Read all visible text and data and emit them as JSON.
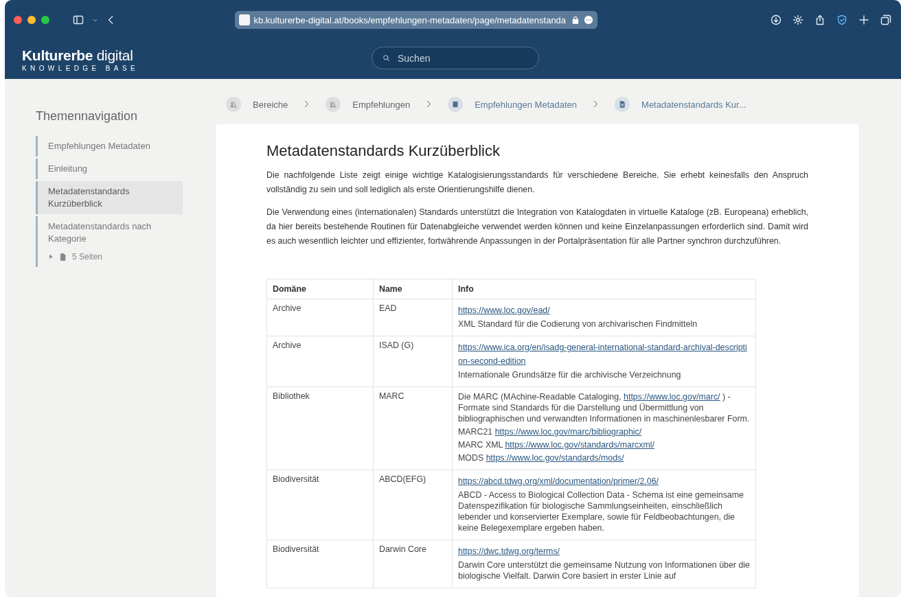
{
  "browser": {
    "url": "kb.kulturerbe-digital.at/books/empfehlungen-metadaten/page/metadatenstanda"
  },
  "site": {
    "logo_bold": "Kulturerbe",
    "logo_light": "digital",
    "tagline": "KNOWLEDGE BASE",
    "search": {
      "placeholder": "Suchen"
    }
  },
  "sidebar": {
    "title": "Themennavigation",
    "items": [
      {
        "label": "Empfehlungen Metadaten",
        "selected": false
      },
      {
        "label": "Einleitung",
        "selected": false
      },
      {
        "label": "Metadatenstandards Kurzüberblick",
        "selected": true
      },
      {
        "label": "Metadatenstandards nach Kategorie",
        "selected": false,
        "pages": {
          "label": "5 Seiten",
          "expanded": false
        }
      }
    ]
  },
  "breadcrumbs": [
    {
      "label": "Bereiche",
      "kind": "shelves"
    },
    {
      "label": "Empfehlungen",
      "kind": "shelves"
    },
    {
      "label": "Empfehlungen Metadaten",
      "kind": "book"
    },
    {
      "label": "Metadatenstandards Kur...",
      "kind": "page"
    }
  ],
  "page": {
    "title": "Metadatenstandards Kurzüberblick",
    "paragraphs": [
      "Die nachfolgende Liste zeigt einige wichtige Katalogisierungsstandards für verschiedene Bereiche. Sie erhebt keinesfalls den Anspruch vollständig zu sein und soll lediglich als erste Orientierungshilfe dienen.",
      "Die Verwendung eines (internationalen) Standards unterstützt die Integration von Katalogdaten in virtuelle Kataloge (zB. Europeana) erheblich, da hier bereits bestehende Routinen für Datenabgleiche verwendet werden können und keine Einzelanpassungen erforderlich sind. Damit wird es auch wesentlich leichter und effizienter, fortwährende Anpassungen in der Portalpräsentation für alle Partner synchron durchzuführen."
    ]
  },
  "table": {
    "columns": [
      "Domäne",
      "Name",
      "Info"
    ],
    "rows": [
      {
        "domain": "Archive",
        "name": "EAD",
        "info": [
          [
            {
              "kind": "link",
              "text": "https://www.loc.gov/ead/"
            }
          ],
          [
            {
              "kind": "text",
              "text": "XML Standard für die Codierung von archivarischen Findmitteln"
            }
          ]
        ]
      },
      {
        "domain": "Archive",
        "name": "ISAD (G)",
        "info": [
          [
            {
              "kind": "link",
              "text": "https://www.ica.org/en/isadg-general-international-standard-archival-description-second-edition"
            }
          ],
          [
            {
              "kind": "text",
              "text": "Internationale Grundsätze für die archivische Verzeichnung"
            }
          ]
        ]
      },
      {
        "domain": "Bibliothek",
        "name": "MARC",
        "info": [
          [
            {
              "kind": "text",
              "text": "Die MARC (MAchine-Readable Cataloging, "
            },
            {
              "kind": "link",
              "text": "https://www.loc.gov/marc/"
            },
            {
              "kind": "text",
              "text": " ) - Formate sind Standards für die Darstellung und Übermittlung von bibliographischen und verwandten Informationen in maschinenlesbarer Form."
            }
          ],
          [
            {
              "kind": "text",
              "text": "MARC21 "
            },
            {
              "kind": "link",
              "text": "https://www.loc.gov/marc/bibliographic/"
            }
          ],
          [
            {
              "kind": "text",
              "text": "MARC XML "
            },
            {
              "kind": "link",
              "text": "https://www.loc.gov/standards/marcxml/"
            }
          ],
          [
            {
              "kind": "text",
              "text": "MODS "
            },
            {
              "kind": "link",
              "text": "https://www.loc.gov/standards/mods/"
            }
          ]
        ]
      },
      {
        "domain": "Biodiversität",
        "name": "ABCD(EFG)",
        "info": [
          [
            {
              "kind": "link",
              "text": "https://abcd.tdwg.org/xml/documentation/primer/2.06/"
            }
          ],
          [
            {
              "kind": "text",
              "text": "ABCD - Access to Biological Collection Data - Schema ist eine gemeinsame Datenspezifikation für biologische Sammlungseinheiten, einschließlich lebender und konservierter Exemplare, sowie für Feldbeobachtungen, die keine Belegexemplare ergeben haben."
            }
          ]
        ]
      },
      {
        "domain": "Biodiversität",
        "name": "Darwin Core",
        "info": [
          [
            {
              "kind": "link",
              "text": "https://dwc.tdwg.org/terms/"
            }
          ],
          [
            {
              "kind": "text",
              "text": "Darwin Core unterstützt die gemeinsame Nutzung von Informationen über die biologische Vielfalt. Darwin Core basiert in erster Linie auf"
            }
          ]
        ]
      }
    ]
  }
}
